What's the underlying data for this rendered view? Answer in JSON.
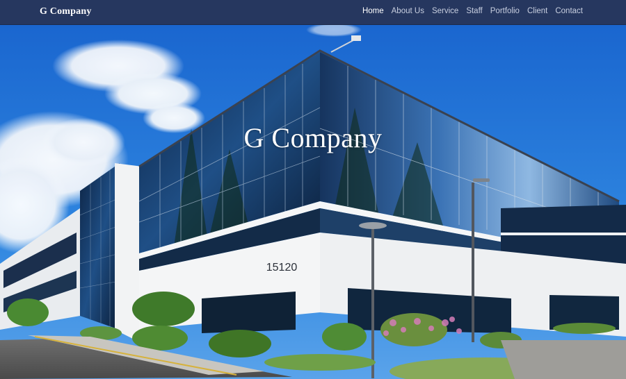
{
  "brand": {
    "name": "G Company"
  },
  "nav": {
    "items": [
      {
        "label": "Home",
        "active": true
      },
      {
        "label": "About Us",
        "active": false
      },
      {
        "label": "Service",
        "active": false
      },
      {
        "label": "Staff",
        "active": false
      },
      {
        "label": "Portfolio",
        "active": false
      },
      {
        "label": "Client",
        "active": false
      },
      {
        "label": "Contact",
        "active": false
      }
    ]
  },
  "hero": {
    "title": "G Company",
    "building_number": "15120"
  },
  "colors": {
    "navbar": "#26375f",
    "nav_active": "#ffffff",
    "nav_inactive": "#c8cfe0",
    "sky": "#1f6fd0"
  }
}
